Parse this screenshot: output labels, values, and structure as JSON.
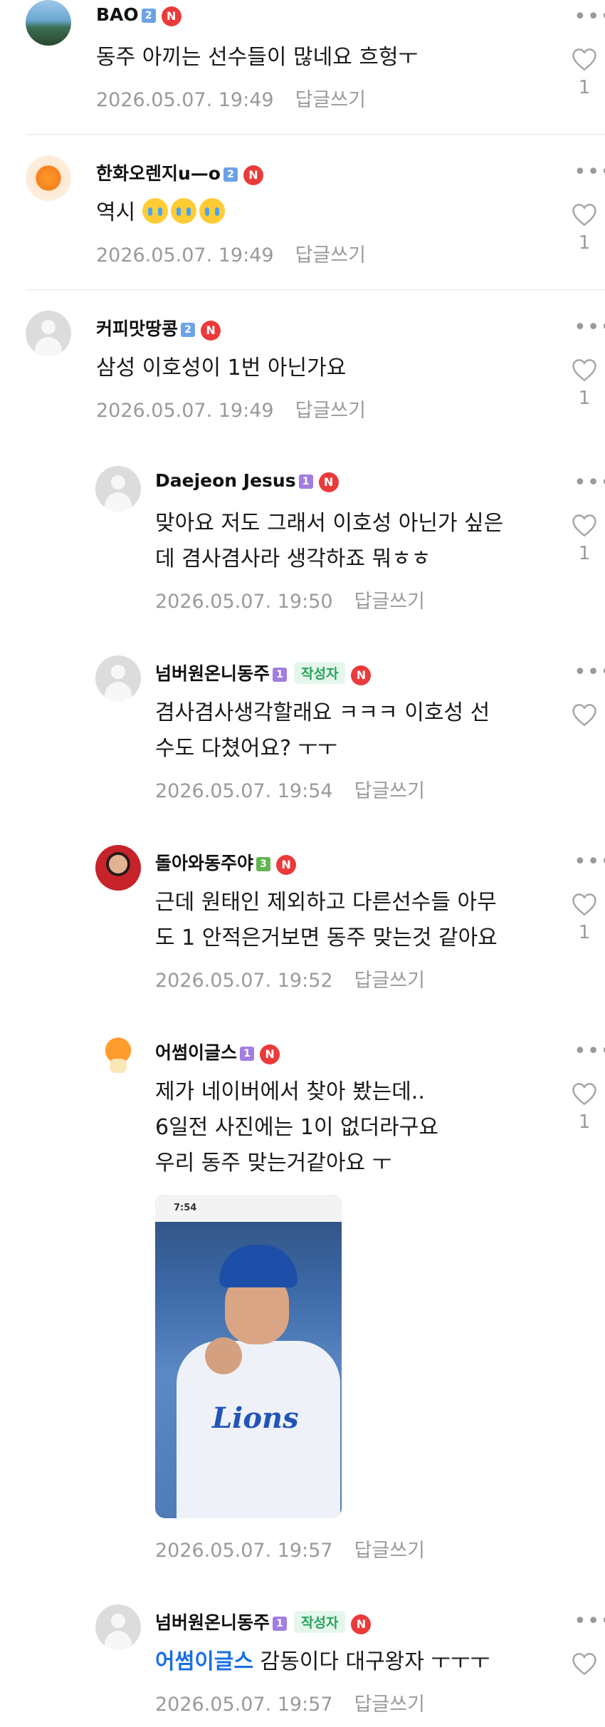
{
  "comments": [
    {
      "name": "BAO",
      "level": "2",
      "text": "동주 아끼는 선수들이 많네요 흐헝ㅜ",
      "time": "2026.05.07. 19:49",
      "reply": "답글쓰기",
      "likes": "1"
    },
    {
      "name": "한화오렌지u—o",
      "level": "2",
      "text": "역시",
      "time": "2026.05.07. 19:49",
      "reply": "답글쓰기",
      "likes": "1"
    },
    {
      "name": "커피맛땅콩",
      "level": "2",
      "text": "삼성 이호성이 1번 아닌가요",
      "time": "2026.05.07. 19:49",
      "reply": "답글쓰기",
      "likes": "1"
    }
  ],
  "replies": [
    {
      "name": "Daejeon Jesus",
      "level": "1",
      "lines": [
        "맞아요 저도 그래서 이호성 아닌가 싶은",
        "데 겸사겸사라 생각하죠 뭐ㅎㅎ"
      ],
      "time": "2026.05.07. 19:50",
      "reply": "답글쓰기",
      "likes": "1"
    },
    {
      "name": "넘버원온니동주",
      "level": "1",
      "badge": "작성자",
      "lines": [
        "겸사겸사생각할래요 ㅋㅋㅋ 이호성 선",
        "수도 다쳤어요? ㅜㅜ"
      ],
      "time": "2026.05.07. 19:54",
      "reply": "답글쓰기"
    },
    {
      "name": "돌아와동주야",
      "level": "3",
      "lines": [
        "근데 원태인 제외하고 다른선수들 아무",
        "도 1 안적은거보면 동주 맞는것 같아요"
      ],
      "time": "2026.05.07. 19:52",
      "reply": "답글쓰기",
      "likes": "1"
    },
    {
      "name": "어썸이글스",
      "level": "1",
      "lines": [
        "제가 네이버에서 찾아 봤는데..",
        "6일전 사진에는 1이 없더라구요",
        "우리 동주 맞는거같아요 ㅜ"
      ],
      "time": "2026.05.07. 19:57",
      "reply": "답글쓰기",
      "likes": "1",
      "photo_status_time": "7:54",
      "photo_jersey_text": "Lions"
    },
    {
      "name": "넘버원온니동주",
      "level": "1",
      "badge": "작성자",
      "mention": "어썸이글스",
      "text": "감동이다 대구왕자 ㅜㅜㅜ",
      "time": "2026.05.07. 19:57",
      "reply": "답글쓰기"
    }
  ],
  "icons": {
    "more": "more-dots-icon",
    "heart": "heart-outline-icon",
    "naver_badge": "N"
  },
  "colors": {
    "badge_red": "#ea3a3a",
    "writer_green": "#27a35a",
    "mention_blue": "#1b6fe0",
    "meta_gray": "#9a9a9a"
  }
}
